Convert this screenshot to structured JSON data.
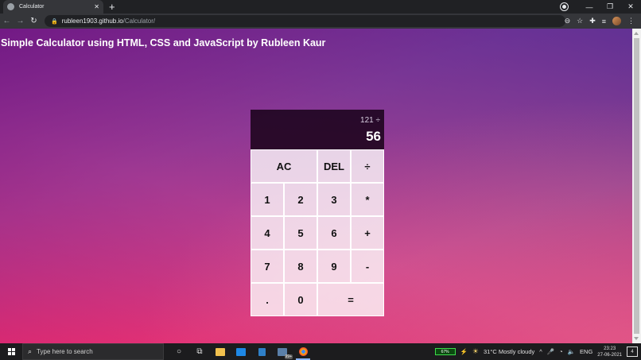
{
  "browser": {
    "tab_title": "Calculator",
    "tab_close": "✕",
    "new_tab": "+",
    "url_host": "rubleen1903.github.io",
    "url_path": "/Calculator/",
    "window_controls": [
      "—",
      "❐",
      "✕"
    ]
  },
  "page": {
    "title": "Simple Calculator using HTML, CSS and JavaScript by Rubleen Kaur"
  },
  "calculator": {
    "previous_operand": "121 ÷",
    "current_operand": "56",
    "keys": {
      "ac": "AC",
      "del": "DEL",
      "divide": "÷",
      "one": "1",
      "two": "2",
      "three": "3",
      "multiply": "*",
      "four": "4",
      "five": "5",
      "six": "6",
      "plus": "+",
      "seven": "7",
      "eight": "8",
      "nine": "9",
      "minus": "-",
      "dot": ".",
      "zero": "0",
      "equals": "="
    }
  },
  "taskbar": {
    "search_placeholder": "Type here to search",
    "chrome_badge": "99+",
    "battery_text": "67%",
    "weather": "31°C  Mostly cloudy",
    "language": "ENG",
    "time": "23:23",
    "date": "27-06-2021",
    "notification_count": "4"
  },
  "colors": {
    "display_bg": "#1a0a1c",
    "key_bg": "#f1e3ee",
    "gradient_top": "#5c1f8c",
    "gradient_bottom": "#ee2a6e"
  }
}
